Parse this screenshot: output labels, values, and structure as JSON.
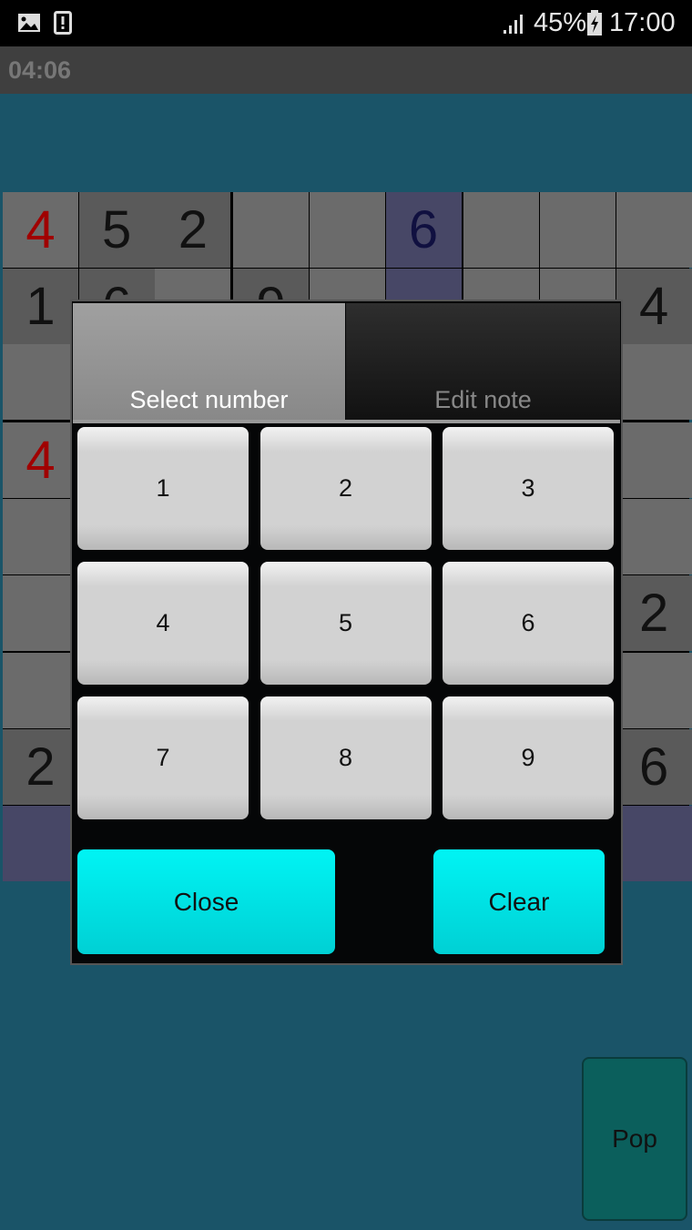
{
  "status_bar": {
    "battery": "45%",
    "time": "17:00",
    "icons": [
      "image-icon",
      "alert-icon",
      "signal-icon",
      "battery-charging-icon"
    ]
  },
  "timer": "04:06",
  "grid": {
    "highlight_row": 8,
    "highlight_col": 5,
    "given": [
      [
        0,
        1
      ],
      [
        0,
        2
      ],
      [
        1,
        0
      ],
      [
        1,
        1
      ],
      [
        1,
        3
      ],
      [
        1,
        8
      ],
      [
        5,
        8
      ],
      [
        7,
        0
      ],
      [
        7,
        8
      ]
    ],
    "cells": [
      {
        "r": 0,
        "c": 0,
        "v": "4",
        "color": "#a00000"
      },
      {
        "r": 0,
        "c": 1,
        "v": "5",
        "color": "#111111"
      },
      {
        "r": 0,
        "c": 2,
        "v": "2",
        "color": "#111111"
      },
      {
        "r": 0,
        "c": 5,
        "v": "6",
        "color": "#101040"
      },
      {
        "r": 1,
        "c": 0,
        "v": "1",
        "color": "#111111"
      },
      {
        "r": 1,
        "c": 1,
        "v": "6",
        "color": "#111111"
      },
      {
        "r": 1,
        "c": 3,
        "v": "9",
        "color": "#111111"
      },
      {
        "r": 1,
        "c": 8,
        "v": "4",
        "color": "#111111"
      },
      {
        "r": 3,
        "c": 0,
        "v": "4",
        "color": "#a00000"
      },
      {
        "r": 5,
        "c": 8,
        "v": "2",
        "color": "#111111"
      },
      {
        "r": 7,
        "c": 0,
        "v": "2",
        "color": "#111111"
      },
      {
        "r": 7,
        "c": 8,
        "v": "6",
        "color": "#111111"
      }
    ]
  },
  "dialog": {
    "tabs": [
      {
        "label": "Select number",
        "active": true
      },
      {
        "label": "Edit note",
        "active": false
      }
    ],
    "numbers": [
      "1",
      "2",
      "3",
      "4",
      "5",
      "6",
      "7",
      "8",
      "9"
    ],
    "close_label": "Close",
    "clear_label": "Clear"
  },
  "pop_label": "Pop"
}
